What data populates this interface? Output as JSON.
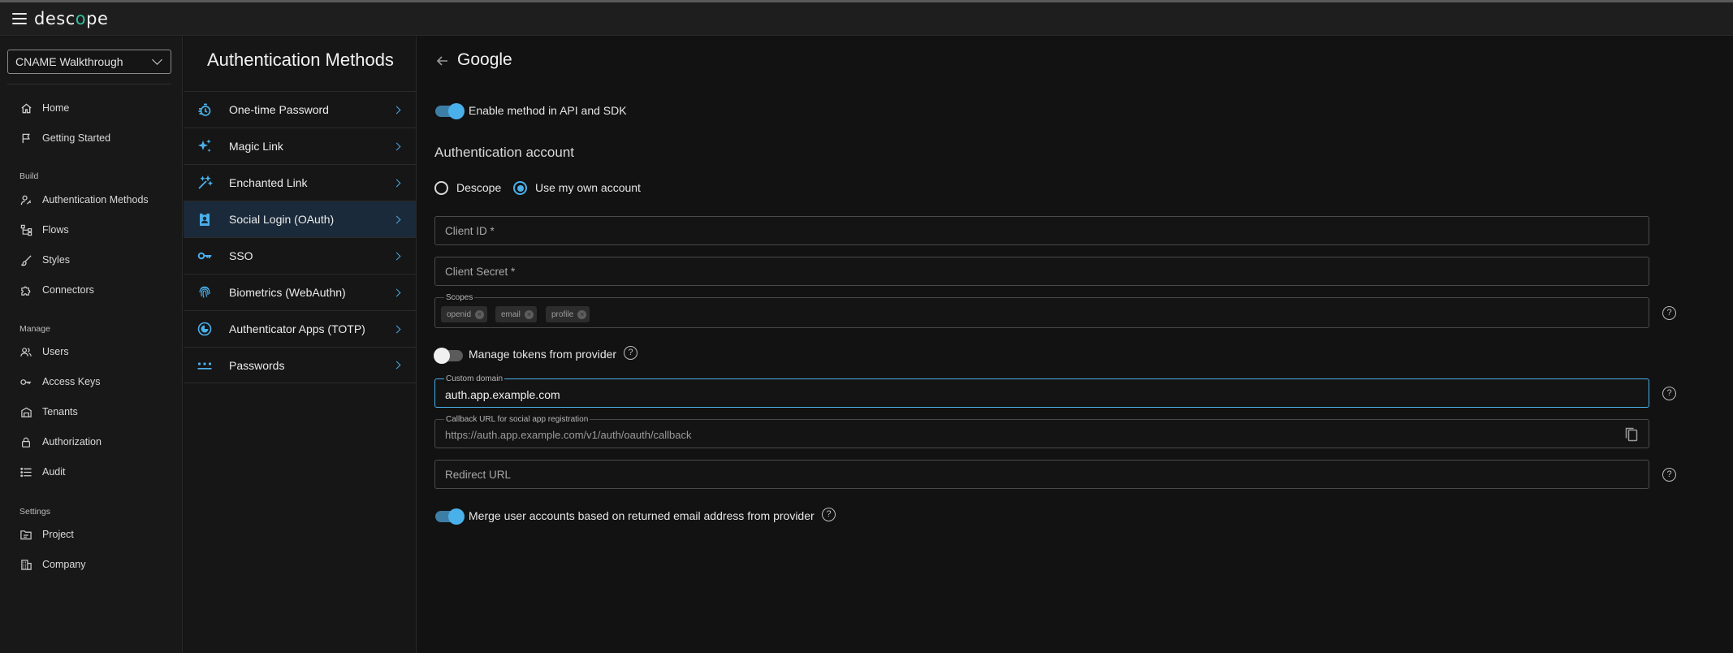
{
  "app": {
    "logo_prefix": "desc",
    "logo_accent": "o",
    "logo_suffix": "pe"
  },
  "project": {
    "selected": "CNAME Walkthrough"
  },
  "sidebar": {
    "top_items": [
      {
        "label": "Home",
        "icon": "home-icon"
      },
      {
        "label": "Getting Started",
        "icon": "flag-icon"
      }
    ],
    "sections": [
      {
        "title": "Build",
        "items": [
          {
            "label": "Authentication Methods",
            "icon": "user-key-icon"
          },
          {
            "label": "Flows",
            "icon": "flow-icon"
          },
          {
            "label": "Styles",
            "icon": "brush-icon"
          },
          {
            "label": "Connectors",
            "icon": "puzzle-icon"
          }
        ]
      },
      {
        "title": "Manage",
        "items": [
          {
            "label": "Users",
            "icon": "users-icon"
          },
          {
            "label": "Access Keys",
            "icon": "key-icon"
          },
          {
            "label": "Tenants",
            "icon": "building-icon"
          },
          {
            "label": "Authorization",
            "icon": "lock-icon"
          },
          {
            "label": "Audit",
            "icon": "list-icon"
          }
        ]
      },
      {
        "title": "Settings",
        "items": [
          {
            "label": "Project",
            "icon": "folder-icon"
          },
          {
            "label": "Company",
            "icon": "company-icon"
          }
        ]
      }
    ]
  },
  "methods": {
    "title": "Authentication Methods",
    "items": [
      {
        "label": "One-time Password",
        "icon": "stopwatch-icon"
      },
      {
        "label": "Magic Link",
        "icon": "sparkle-icon"
      },
      {
        "label": "Enchanted Link",
        "icon": "wand-icon"
      },
      {
        "label": "Social Login (OAuth)",
        "icon": "contact-badge-icon",
        "active": true
      },
      {
        "label": "SSO",
        "icon": "key-icon"
      },
      {
        "label": "Biometrics (WebAuthn)",
        "icon": "fingerprint-icon"
      },
      {
        "label": "Authenticator Apps (TOTP)",
        "icon": "authenticator-icon"
      },
      {
        "label": "Passwords",
        "icon": "dots-icon"
      }
    ]
  },
  "main": {
    "title": "Google",
    "enable_label": "Enable method in API and SDK",
    "auth_account_title": "Authentication account",
    "radio_descope": "Descope",
    "radio_own": "Use my own account",
    "client_id_placeholder": "Client ID *",
    "client_secret_placeholder": "Client Secret *",
    "scopes_label": "Scopes",
    "scopes": [
      "openid",
      "email",
      "profile"
    ],
    "manage_tokens_label": "Manage tokens from provider",
    "custom_domain_label": "Custom domain",
    "custom_domain_value": "auth.app.example.com",
    "callback_label": "Callback URL for social app registration",
    "callback_value": "https://auth.app.example.com/v1/auth/oauth/callback",
    "redirect_placeholder": "Redirect URL",
    "merge_label": "Merge user accounts based on returned email address from provider",
    "help_glyph": "?"
  },
  "colors": {
    "accent": "#4ab0ea",
    "active_row": "#1b2a3a",
    "logo_accent": "#2ec1a0"
  }
}
